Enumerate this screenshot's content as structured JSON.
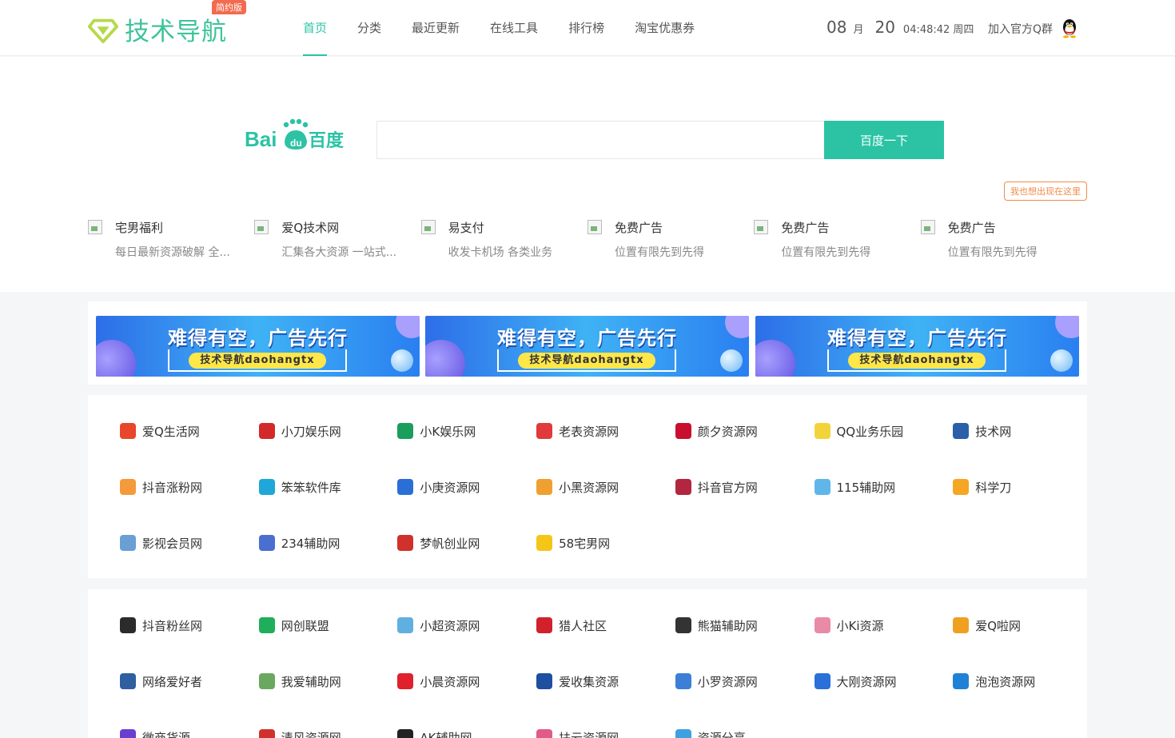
{
  "header": {
    "logo_text": "技术导航",
    "logo_badge": "简约版",
    "nav": [
      {
        "label": "首页",
        "active": true
      },
      {
        "label": "分类"
      },
      {
        "label": "最近更新"
      },
      {
        "label": "在线工具"
      },
      {
        "label": "排行榜"
      },
      {
        "label": "淘宝优惠券"
      }
    ],
    "clock": {
      "month": "08",
      "month_unit": "月",
      "day": "20",
      "time": "04:48:42",
      "weekday": "周四"
    },
    "qq_join": "加入官方Q群"
  },
  "search": {
    "engine": "Baidu 百度",
    "button": "百度一下",
    "value": "",
    "placeholder": ""
  },
  "promo_link": "我也想出现在这里",
  "text_ads": [
    {
      "title": "宅男福利",
      "desc": "每日最新资源破解 全..."
    },
    {
      "title": "爱Q技术网",
      "desc": "汇集各大资源 一站式..."
    },
    {
      "title": "易支付",
      "desc": "收发卡机场 各类业务"
    },
    {
      "title": "免费广告",
      "desc": "位置有限先到先得"
    },
    {
      "title": "免费广告",
      "desc": "位置有限先到先得"
    },
    {
      "title": "免费广告",
      "desc": "位置有限先到先得"
    }
  ],
  "banners": [
    {
      "headline": "难得有空，广告先行",
      "tagline": "技术导航daohangtx"
    },
    {
      "headline": "难得有空，广告先行",
      "tagline": "技术导航daohangtx"
    },
    {
      "headline": "难得有空，广告先行",
      "tagline": "技术导航daohangtx"
    }
  ],
  "sites_block1": [
    {
      "name": "爱Q生活网",
      "icon": "bear-icon",
      "color": "#e8462b"
    },
    {
      "name": "小刀娱乐网",
      "icon": "knife-icon",
      "color": "#d22a2a"
    },
    {
      "name": "小K娱乐网",
      "icon": "k-icon",
      "color": "#1a9e5c"
    },
    {
      "name": "老表资源网",
      "icon": "seal-icon",
      "color": "#e03a3a"
    },
    {
      "name": "颜夕资源网",
      "icon": "yan-icon",
      "color": "#c8102e"
    },
    {
      "name": "QQ业务乐园",
      "icon": "banana-icon",
      "color": "#f2d43a"
    },
    {
      "name": "技术网",
      "icon": "stripe-icon",
      "color": "#2b5fa8"
    },
    {
      "name": "抖音涨粉网",
      "icon": "orange-box-icon",
      "color": "#f59a3b"
    },
    {
      "name": "笨笨软件库",
      "icon": "circle-c-icon",
      "color": "#1ea7d8"
    },
    {
      "name": "小庚资源网",
      "icon": "cube-icon",
      "color": "#2a6fd6"
    },
    {
      "name": "小黑资源网",
      "icon": "badge-icon",
      "color": "#f0a030"
    },
    {
      "name": "抖音官方网",
      "icon": "panda-icon",
      "color": "#b3263f"
    },
    {
      "name": "115辅助网",
      "icon": "orb-icon",
      "color": "#5fb6e8"
    },
    {
      "name": "科学刀",
      "icon": "pen-icon",
      "color": "#f5a623"
    },
    {
      "name": "影视会员网",
      "icon": "trophy-icon",
      "color": "#6a9fd4"
    },
    {
      "name": "234辅助网",
      "icon": "bars-icon",
      "color": "#4a6fd0"
    },
    {
      "name": "梦帆创业网",
      "icon": "flag-icon",
      "color": "#d0312d"
    },
    {
      "name": "58宅男网",
      "icon": "banana-icon",
      "color": "#f5c518"
    }
  ],
  "sites_block2": [
    {
      "name": "抖音粉丝网",
      "icon": "fans-icon",
      "color": "#2b2b2b"
    },
    {
      "name": "网创联盟",
      "icon": "meng-icon",
      "color": "#1fae5a"
    },
    {
      "name": "小超资源网",
      "icon": "wave-icon",
      "color": "#5fb0e0"
    },
    {
      "name": "猎人社区",
      "icon": "hunter-icon",
      "color": "#d0212d"
    },
    {
      "name": "熊猫辅助网",
      "icon": "panda-icon",
      "color": "#333333"
    },
    {
      "name": "小Ki资源",
      "icon": "k-icon",
      "color": "#e98aa6"
    },
    {
      "name": "爱Q啦网",
      "icon": "q-icon",
      "color": "#f0a020"
    },
    {
      "name": "网络爱好者",
      "icon": "bars-icon",
      "color": "#2f5fa0"
    },
    {
      "name": "我爱辅助网",
      "icon": "tree-icon",
      "color": "#6aa860"
    },
    {
      "name": "小晨资源网",
      "icon": "heart-icon",
      "color": "#e0202a"
    },
    {
      "name": "爱收集资源",
      "icon": "shell-icon",
      "color": "#1e4fa0"
    },
    {
      "name": "小罗资源网",
      "icon": "g-icon",
      "color": "#3b7fd6"
    },
    {
      "name": "大刚资源网",
      "icon": "d-icon",
      "color": "#2a70d8"
    },
    {
      "name": "泡泡资源网",
      "icon": "bubble-icon",
      "color": "#1f82d6"
    },
    {
      "name": "微商货源",
      "icon": "seven-icon",
      "color": "#6a3fd0"
    },
    {
      "name": "清风资源网",
      "icon": "fire-icon",
      "color": "#d0312d"
    },
    {
      "name": "AK辅助网",
      "icon": "gun-icon",
      "color": "#222222"
    },
    {
      "name": "扶云资源网",
      "icon": "dots-icon",
      "color": "#e05a8a"
    },
    {
      "name": "资源分享",
      "icon": "share-icon",
      "color": "#3fa0e0"
    }
  ]
}
